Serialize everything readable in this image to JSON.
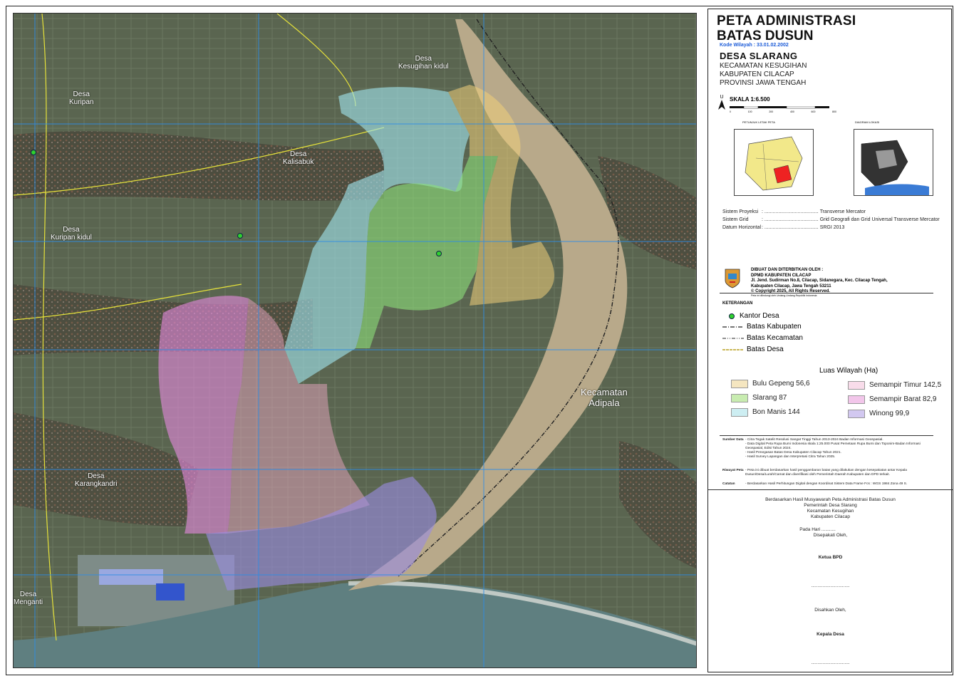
{
  "title": {
    "line1": "PETA ADMINISTRASI",
    "line2": "BATAS DUSUN"
  },
  "kode_wilayah": "Kode Wilayah : 33.01.02.2002",
  "desa": "DESA SLARANG",
  "admin_lines": [
    "KECAMATAN KESUGIHAN",
    "KABUPATEN CILACAP",
    "PROVINSI JAWA TENGAH"
  ],
  "north_label": "U",
  "skala": "SKALA 1:6.500",
  "scale_ticks": [
    "0",
    "100",
    "200",
    "400",
    "600",
    "800"
  ],
  "inset1_title": "PETUNJUK LETAK PETA",
  "inset2_title": "DIAGRAM LOKASI",
  "projection": [
    {
      "label": "Sistem Proyeksi",
      "value": "Transverse Mercator"
    },
    {
      "label": "Sistem Grid",
      "value": "Grid Geografi dan Grid Universal Transverse Mercator"
    },
    {
      "label": "Datum Horizontal",
      "value": "SRGI 2013"
    }
  ],
  "publisher": {
    "heading": "DIBUAT DAN DITERBITKAN OLEH :",
    "org": "DPMD KABUPATEN CILACAP",
    "address1": "Jl. Jend. Sudirman No.8, Cilacap, Sidanegara, Kec. Cilacap Tengah,",
    "address2": "Kabupaten Cilacap, Jawa Tengah 53211",
    "copyright": "© Copyright 2025, All Rights Reserved.",
    "note": "Peta ini dilindungi oleh Undang-Undang Republik Indonesia"
  },
  "keterangan_title": "KETERANGAN",
  "legend": [
    {
      "label": "Kantor Desa",
      "icon": "green-dot"
    },
    {
      "label": "Batas Kabupaten",
      "icon": "dash-dot-line"
    },
    {
      "label": "Batas Kecamatan",
      "icon": "dash-dot-dot-line"
    },
    {
      "label": "Batas Desa",
      "icon": "yellow-dashed-line"
    }
  ],
  "luas_title": "Luas Wilayah (Ha)",
  "luas": [
    {
      "label": "Bulu Gepeng 56,6",
      "color": "#f5e6c0"
    },
    {
      "label": "Slarang 87",
      "color": "#c8ecb0"
    },
    {
      "label": "Bon Manis 144",
      "color": "#cdeef2"
    },
    {
      "label": "Semampir Timur 142,5",
      "color": "#f8dcea"
    },
    {
      "label": "Semampir Barat 82,9",
      "color": "#f2c6ea"
    },
    {
      "label": "Winong 99,9",
      "color": "#d2c8f0"
    }
  ],
  "sumber": {
    "label": "Sumber Data",
    "items": [
      "- Citra Tegak Satelit Resolusi Sangat Tinggi Tahun 2013-2024 Badan Informasi Geospasial.",
      "- Data Digital Peta Rupa Bumi Indonesia skala 1:25.000 Pusat Pemetaan Rupa Bumi dan Toponim-Badan Informasi Geospasial, Edisi Tahun 2024.",
      "- Hasil Penegasan Batas Desa Kabupaten Cilacap Tahun 2021.",
      "- Hasil Survey Lapangan dan Interpretasi Citra Tahun 2025."
    ]
  },
  "riwayat": {
    "label": "Riwayat Peta",
    "text": "- Peta ini dibuat berdasarkan hasil penggambaran batas yang dilakukan dengan kesepakatan antar Kepala Dusun/Desa/Lurah/Camat dan diverifikasi oleh Pemerintah Daerah Kabupaten dan DPD terkait."
  },
  "catatan": {
    "label": "Catatan",
    "text": "- Berdasarkan Hasil Perhitungan Digital dengan Koordinat Sistem Data Frame Fcs : WGS 1984 Zona 49 S."
  },
  "signature": {
    "intro": "Berdasarkan Hasil Musyawarah Peta Administrasi Batas Dusun",
    "l1": "Pemerintah Desa Slarang",
    "l2": "Kecamatan Kesugihan",
    "l3": "Kabupaten Cilacap",
    "pada": "Pada Hari ...........",
    "disepakati": "Disepakati Oleh,",
    "ketua": "Ketua BPD",
    "dots1": "..............................",
    "disahkan": "Disahkan Oleh,",
    "kepala": "Kepala Desa",
    "dots2": ".............................."
  },
  "map_labels": [
    {
      "text": "Desa",
      "sub": "Kesugihan kidul"
    },
    {
      "text": "Desa",
      "sub": "Kuripan"
    },
    {
      "text": "Desa",
      "sub": "Kalisabuk"
    },
    {
      "text": "Desa",
      "sub": "Kuripan kidul"
    },
    {
      "text": "Desa",
      "sub": "Karangkandri"
    },
    {
      "text": "Desa",
      "sub": "Menganti"
    },
    {
      "text": "Kecamatan",
      "sub": "Adipala"
    }
  ],
  "colors": {
    "grid": "#2e8de6",
    "river": "#b9a98a",
    "land": "#4f5a47",
    "sea": "#5b7a7a"
  }
}
